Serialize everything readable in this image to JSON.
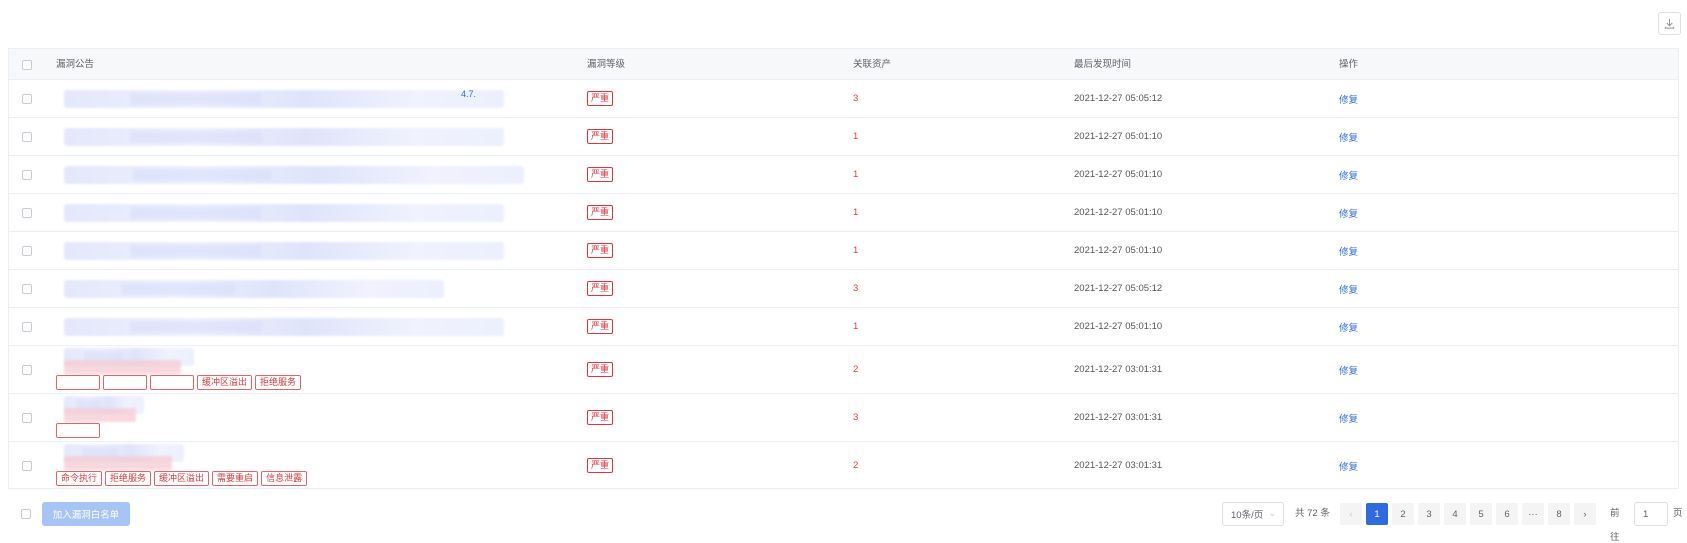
{
  "toolbar": {
    "export_icon": "download-icon"
  },
  "table": {
    "columns": [
      "漏洞公告",
      "漏洞等级",
      "关联资产",
      "最后发现时间",
      "操作"
    ],
    "rows": [
      {
        "severity": "严重",
        "assets": "3",
        "time": "2021-12-27 05:05:12",
        "action": "修复",
        "link_fragment": "4.7.",
        "tags": []
      },
      {
        "severity": "严重",
        "assets": "1",
        "time": "2021-12-27 05:01:10",
        "action": "修复",
        "link_fragment": "",
        "tags": []
      },
      {
        "severity": "严重",
        "assets": "1",
        "time": "2021-12-27 05:01:10",
        "action": "修复",
        "link_fragment": "",
        "tags": []
      },
      {
        "severity": "严重",
        "assets": "1",
        "time": "2021-12-27 05:01:10",
        "action": "修复",
        "link_fragment": "",
        "tags": []
      },
      {
        "severity": "严重",
        "assets": "1",
        "time": "2021-12-27 05:01:10",
        "action": "修复",
        "link_fragment": "",
        "tags": []
      },
      {
        "severity": "严重",
        "assets": "3",
        "time": "2021-12-27 05:05:12",
        "action": "修复",
        "link_fragment": "",
        "tags": []
      },
      {
        "severity": "严重",
        "assets": "1",
        "time": "2021-12-27 05:01:10",
        "action": "修复",
        "link_fragment": "",
        "tags": []
      },
      {
        "severity": "严重",
        "assets": "2",
        "time": "2021-12-27 03:01:31",
        "action": "修复",
        "link_fragment": "",
        "tags": [
          "",
          "",
          "",
          "缓冲区溢出",
          "拒绝服务"
        ]
      },
      {
        "severity": "严重",
        "assets": "3",
        "time": "2021-12-27 03:01:31",
        "action": "修复",
        "link_fragment": "",
        "tags": [
          ""
        ]
      },
      {
        "severity": "严重",
        "assets": "2",
        "time": "2021-12-27 03:01:31",
        "action": "修复",
        "link_fragment": "",
        "tags": [
          "命令执行",
          "拒绝服务",
          "缓冲区溢出",
          "需要重启",
          "信息泄露"
        ]
      }
    ]
  },
  "footer": {
    "whitelist_button": "加入漏洞白名单",
    "page_size": "10条/页",
    "total": "共 72 条",
    "pages": [
      "1",
      "2",
      "3",
      "4",
      "5",
      "6",
      "8"
    ],
    "current_page": "1",
    "ellipsis": "···",
    "goto_prefix": "前往",
    "goto_value": "1",
    "goto_suffix": "页"
  },
  "colors": {
    "primary": "#2f6ae0",
    "danger": "#e0343d",
    "disabled_button": "#a6c4f5"
  }
}
